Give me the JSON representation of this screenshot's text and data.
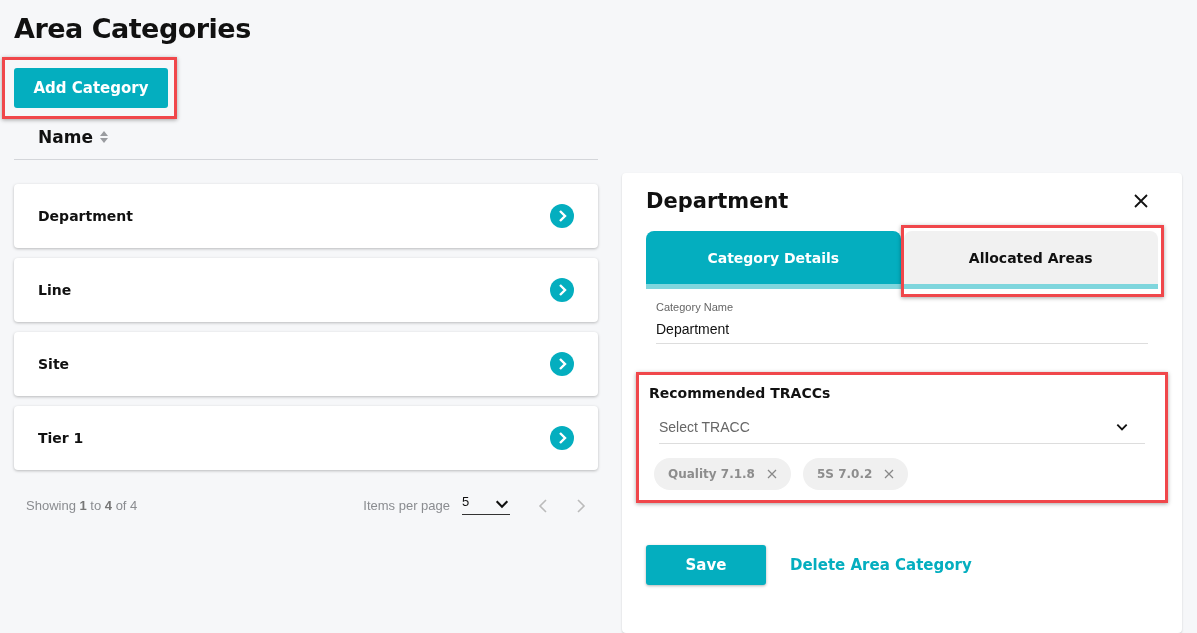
{
  "page": {
    "title": "Area Categories"
  },
  "add_button": {
    "label": "Add Category",
    "highlighted": true
  },
  "list": {
    "sort_column": "Name",
    "rows": [
      {
        "name": "Department"
      },
      {
        "name": "Line"
      },
      {
        "name": "Site"
      },
      {
        "name": "Tier 1"
      }
    ]
  },
  "pagination": {
    "summary": "Showing **1** to **4** of 4",
    "items_per_page_label": "Items per page",
    "items_per_page": "5"
  },
  "panel": {
    "title": "Department",
    "tabs": [
      {
        "label": "Category Details",
        "selected": true,
        "highlighted": false
      },
      {
        "label": "Allocated Areas",
        "selected": false,
        "highlighted": true
      }
    ],
    "category_name": {
      "label": "Category Name",
      "value": "Department"
    },
    "recommended": {
      "heading": "Recommended TRACCs",
      "highlighted": true,
      "select": {
        "placeholder": "Select TRACC"
      },
      "chips": [
        "Quality 7.1.8",
        "5S 7.0.2"
      ]
    },
    "save_button": "Save",
    "delete_link": "Delete Area Category"
  }
}
